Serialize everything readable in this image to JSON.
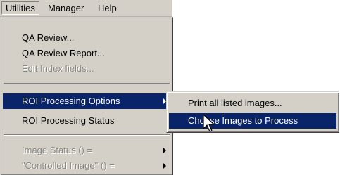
{
  "menubar": {
    "items": [
      {
        "label": "Utilities"
      },
      {
        "label": "Manager"
      },
      {
        "label": "Help"
      }
    ]
  },
  "utilities_menu": {
    "items": [
      {
        "label": "QA Review..."
      },
      {
        "label": "QA Review Report..."
      },
      {
        "label": "Edit Index fields...",
        "disabled": true
      },
      {
        "label": "ROI Processing Options",
        "submenu": true,
        "highlighted": true
      },
      {
        "label": "ROI Processing Status"
      },
      {
        "label": "Image Status () =",
        "disabled": true,
        "submenu": true
      },
      {
        "label": "\"Controlled Image\" () =",
        "disabled": true,
        "submenu": true
      }
    ]
  },
  "roi_submenu": {
    "items": [
      {
        "label": "Print all listed images..."
      },
      {
        "label": "Choose Images to Process",
        "highlighted": true
      }
    ]
  },
  "colors": {
    "menu_bg": "#d4d0c8",
    "highlight_bg": "#0a246a",
    "highlight_fg": "#ffffff",
    "disabled_fg": "#8a877f"
  },
  "cursor": {
    "icon": "arrow-pointer-icon"
  }
}
